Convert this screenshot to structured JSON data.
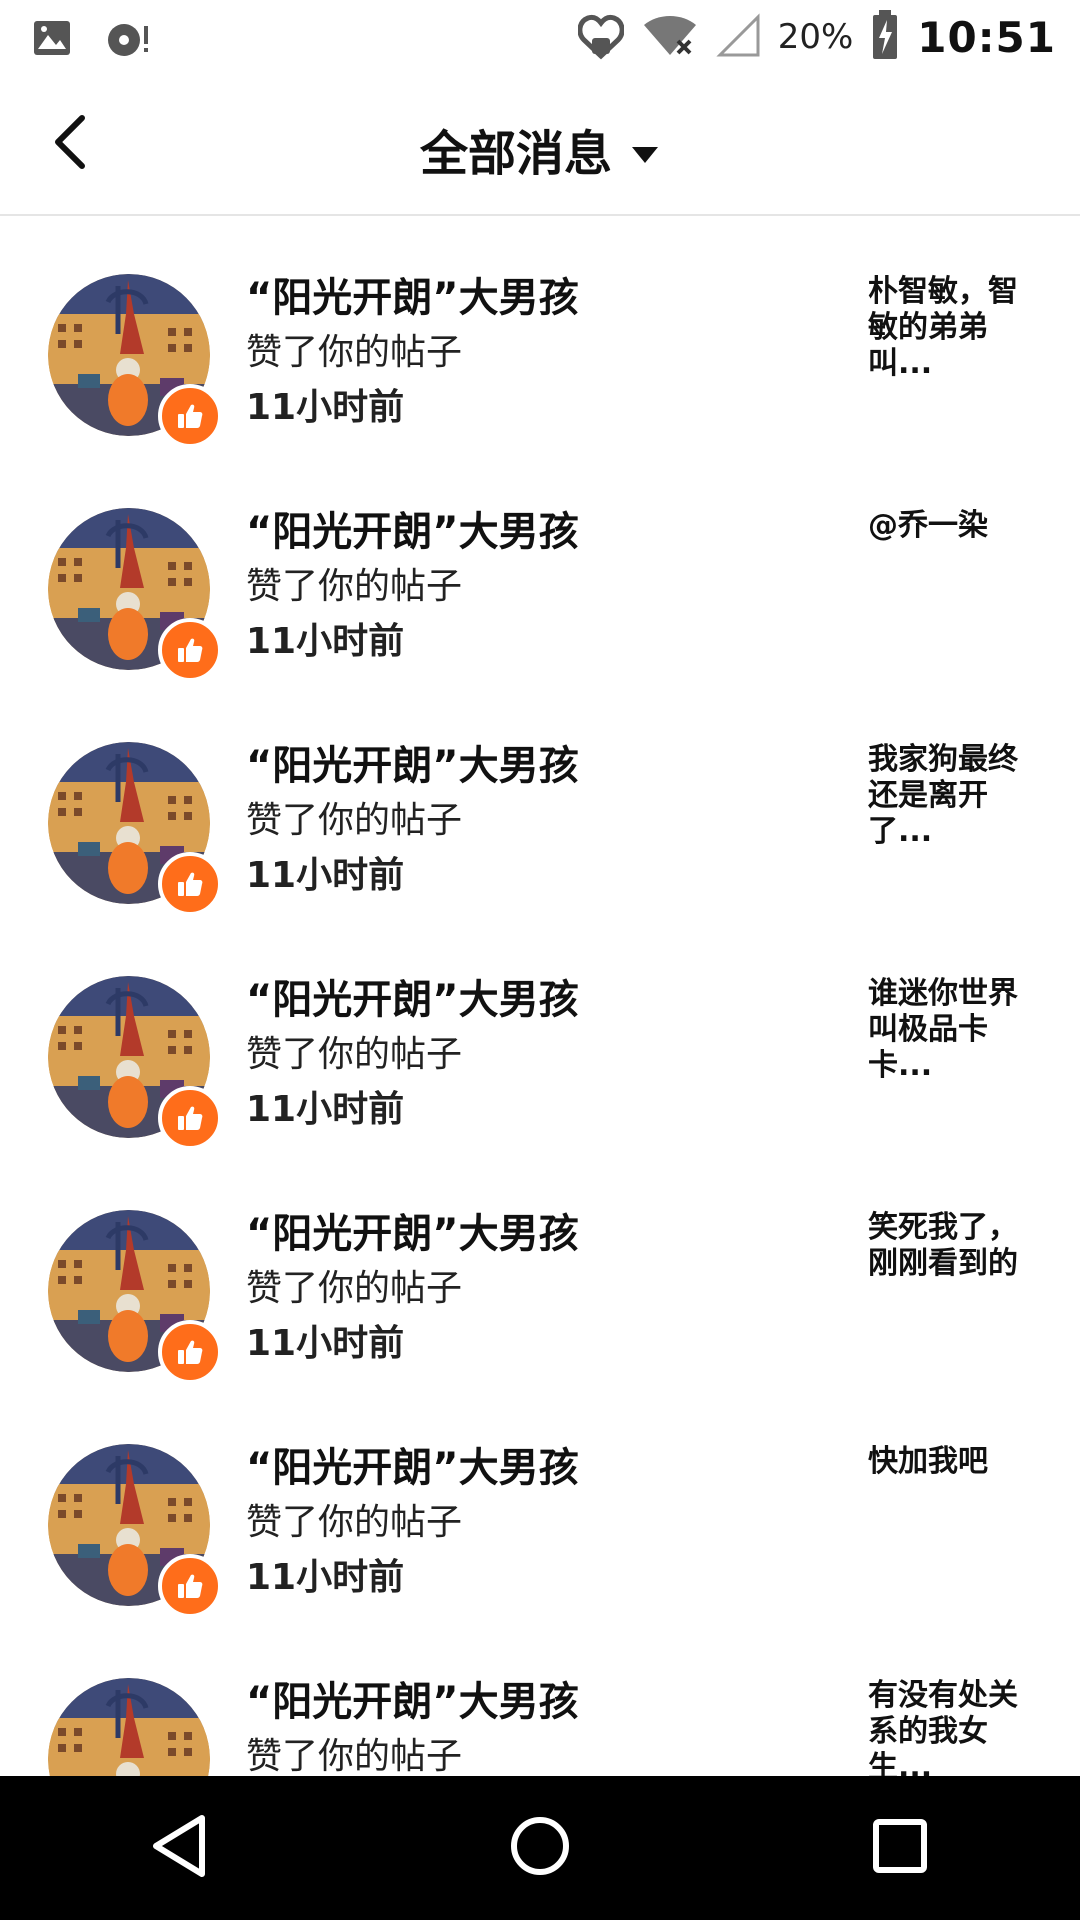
{
  "status_bar": {
    "battery": "20%",
    "time": "10:51"
  },
  "header": {
    "title": "全部消息"
  },
  "icons": {
    "back": "chevron-left-icon",
    "dropdown": "triangle-down-icon",
    "like": "thumbs-up-icon"
  },
  "colors": {
    "accent": "#ff6d1a",
    "navbar": "#000000"
  },
  "notifications": [
    {
      "name": "“阳光开朗”大男孩",
      "action": "赞了你的帖子",
      "time": "11小时前",
      "preview": "朴智敏，智敏的弟弟叫..."
    },
    {
      "name": "“阳光开朗”大男孩",
      "action": "赞了你的帖子",
      "time": "11小时前",
      "preview": "@乔一染"
    },
    {
      "name": "“阳光开朗”大男孩",
      "action": "赞了你的帖子",
      "time": "11小时前",
      "preview": "我家狗最终还是离开了..."
    },
    {
      "name": "“阳光开朗”大男孩",
      "action": "赞了你的帖子",
      "time": "11小时前",
      "preview": "谁迷你世界叫极品卡卡..."
    },
    {
      "name": "“阳光开朗”大男孩",
      "action": "赞了你的帖子",
      "time": "11小时前",
      "preview": "笑死我了，刚刚看到的"
    },
    {
      "name": "“阳光开朗”大男孩",
      "action": "赞了你的帖子",
      "time": "11小时前",
      "preview": "快加我吧"
    },
    {
      "name": "“阳光开朗”大男孩",
      "action": "赞了你的帖子",
      "time": "",
      "preview": "有没有处关系的我女生..."
    }
  ]
}
